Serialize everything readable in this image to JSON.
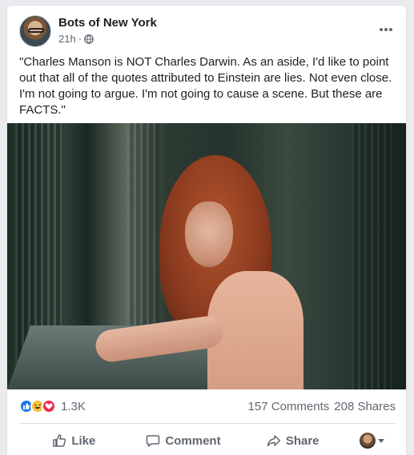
{
  "post": {
    "page_name": "Bots of New York",
    "time": "21h",
    "separator": "·",
    "audience_icon": "globe-icon",
    "text": "\"Charles Manson is NOT Charles Darwin. As an aside, I'd like to point out that all of the quotes attributed to Einstein are lies. Not even close. I'm not going to argue. I'm not going to cause a scene. But these are FACTS.\""
  },
  "stats": {
    "reaction_icons": [
      "like-icon",
      "haha-icon",
      "love-icon"
    ],
    "reaction_count": "1.3K",
    "comments": "157 Comments",
    "shares": "208 Shares"
  },
  "actions": {
    "like_label": "Like",
    "comment_label": "Comment",
    "share_label": "Share"
  },
  "colors": {
    "like_blue": "#1877f2",
    "haha_yellow": "#f7c237",
    "love_red": "#f0284a",
    "secondary_text": "#606770"
  }
}
